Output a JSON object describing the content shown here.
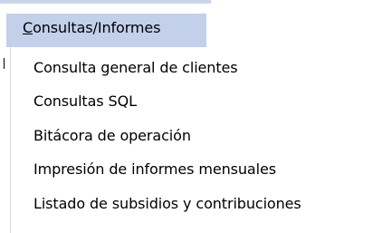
{
  "menubar": {
    "title_first_letter": "C",
    "title_rest": "onsultas/Informes"
  },
  "dropdown": {
    "items": [
      {
        "label": "Consulta general de clientes"
      },
      {
        "label": "Consultas SQL"
      },
      {
        "label": "Bitácora de operación"
      },
      {
        "label": "Impresión de informes mensuales"
      },
      {
        "label": "Listado de subsidios y contribuciones"
      }
    ]
  },
  "colors": {
    "header_highlight": "#c2d0ea",
    "header_top_bar": "#c9d5ea",
    "background": "#ffffff",
    "text": "#000000"
  }
}
